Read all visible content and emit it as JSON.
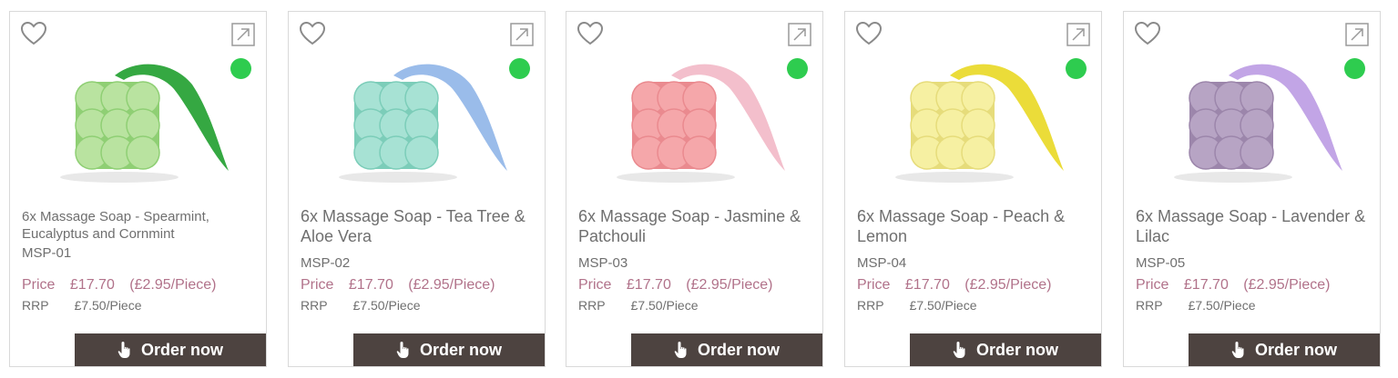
{
  "products": [
    {
      "title": "6x Massage Soap - Spearmint, Eucalyptus and Cornmint",
      "sku": "MSP-01",
      "price_label": "Price",
      "price": "£17.70",
      "per_piece": "(£2.95/Piece)",
      "rrp_label": "RRP",
      "rrp": "£7.50/Piece",
      "order_label": "Order now",
      "soap_color": "#b9e3a0",
      "soap_shade": "#8fcf74",
      "ribbon_color": "#1f9e2e",
      "stock_color": "#2ecc4f",
      "title_size": "small"
    },
    {
      "title": "6x Massage Soap - Tea Tree & Aloe Vera",
      "sku": "MSP-02",
      "price_label": "Price",
      "price": "£17.70",
      "per_piece": "(£2.95/Piece)",
      "rrp_label": "RRP",
      "rrp": "£7.50/Piece",
      "order_label": "Order now",
      "soap_color": "#a7e2d4",
      "soap_shade": "#7ccdb9",
      "ribbon_color": "#8fb5e8",
      "stock_color": "#2ecc4f",
      "title_size": "big"
    },
    {
      "title": "6x Massage Soap - Jasmine & Patchouli",
      "sku": "MSP-03",
      "price_label": "Price",
      "price": "£17.70",
      "per_piece": "(£2.95/Piece)",
      "rrp_label": "RRP",
      "rrp": "£7.50/Piece",
      "order_label": "Order now",
      "soap_color": "#f5a7aa",
      "soap_shade": "#ea8a8f",
      "ribbon_color": "#f2b8c6",
      "stock_color": "#2ecc4f",
      "title_size": "big"
    },
    {
      "title": "6x Massage Soap - Peach & Lemon",
      "sku": "MSP-04",
      "price_label": "Price",
      "price": "£17.70",
      "per_piece": "(£2.95/Piece)",
      "rrp_label": "RRP",
      "rrp": "£7.50/Piece",
      "order_label": "Order now",
      "soap_color": "#f6f0a2",
      "soap_shade": "#e6dc7b",
      "ribbon_color": "#e9d823",
      "stock_color": "#2ecc4f",
      "title_size": "big"
    },
    {
      "title": "6x Massage Soap - Lavender & Lilac",
      "sku": "MSP-05",
      "price_label": "Price",
      "price": "£17.70",
      "per_piece": "(£2.95/Piece)",
      "rrp_label": "RRP",
      "rrp": "£7.50/Piece",
      "order_label": "Order now",
      "soap_color": "#b7a4c4",
      "soap_shade": "#9c86ab",
      "ribbon_color": "#bb9be3",
      "stock_color": "#2ecc4f",
      "title_size": "big"
    }
  ]
}
